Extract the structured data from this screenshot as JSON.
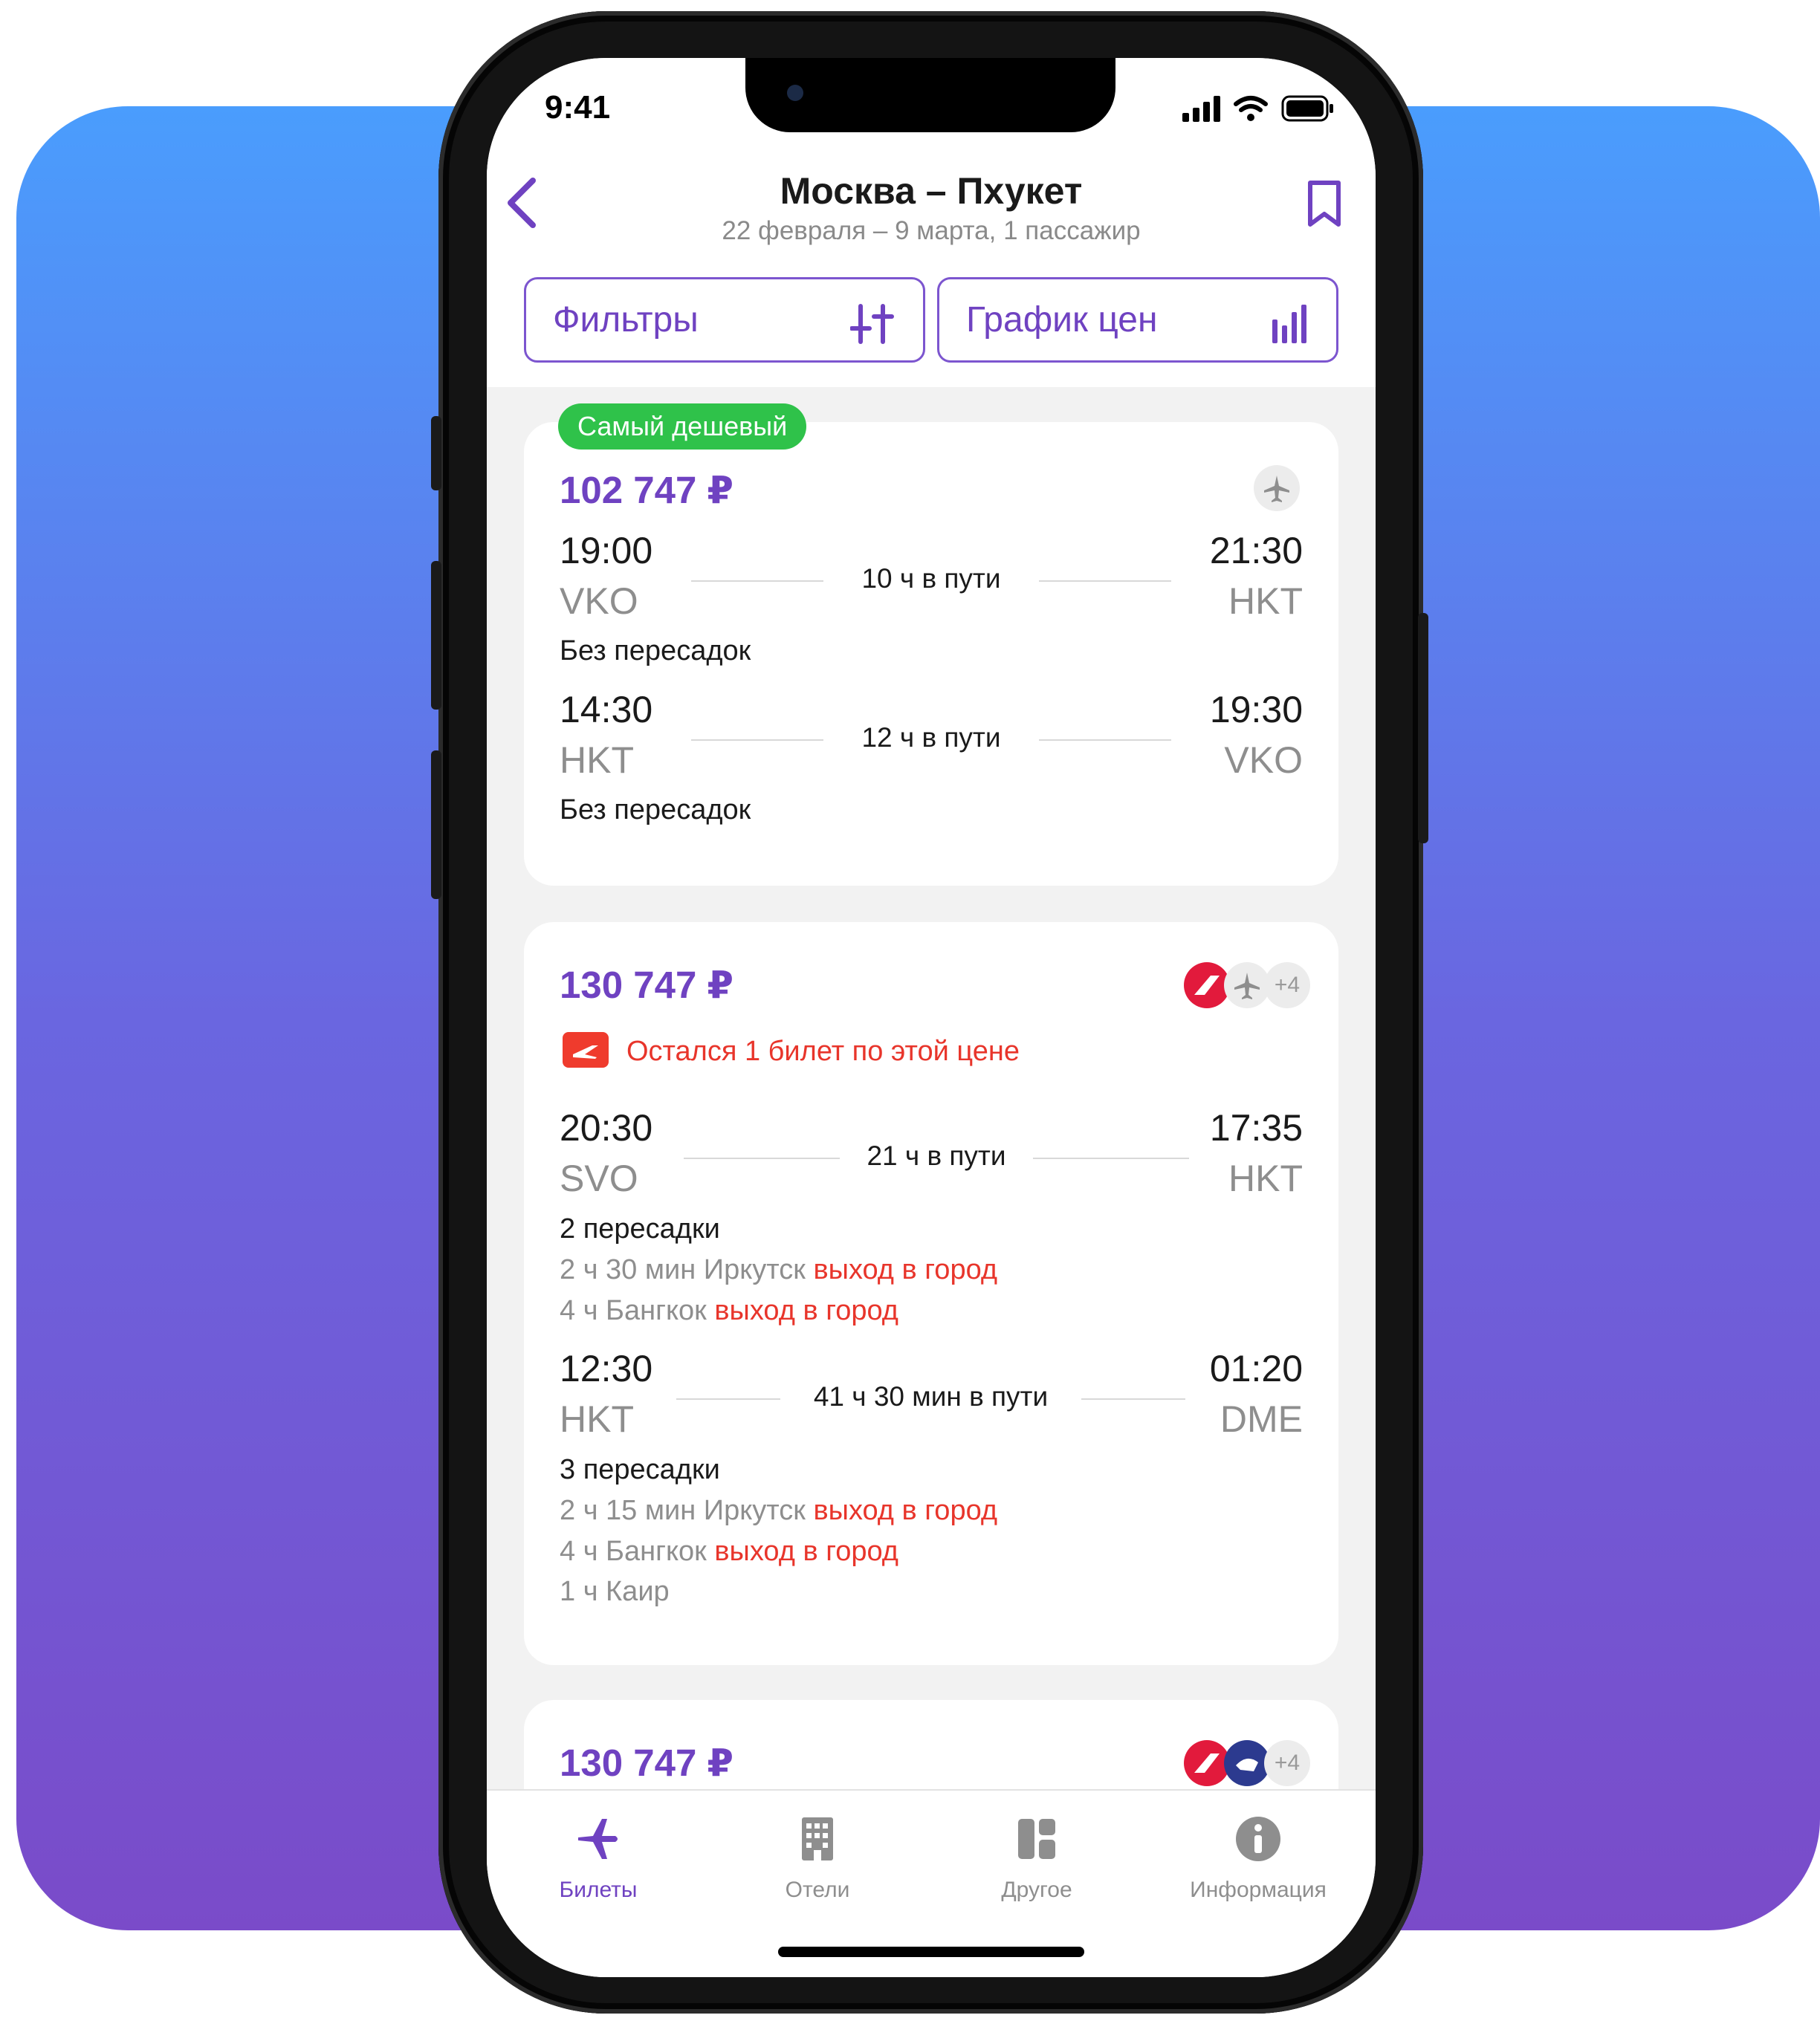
{
  "status": {
    "time": "9:41"
  },
  "header": {
    "title": "Москва – Пхукет",
    "subtitle": "22 февраля – 9 марта, 1 пассажир",
    "filters_label": "Фильтры",
    "price_chart_label": "График цен"
  },
  "cards": [
    {
      "badge": "Самый дешевый",
      "price": "102 747 ₽",
      "legs": [
        {
          "dep_time": "19:00",
          "dep_code": "VKO",
          "duration": "10 ч в пути",
          "arr_time": "21:30",
          "arr_code": "HKT",
          "stops": "Без пересадок"
        },
        {
          "dep_time": "14:30",
          "dep_code": "HKT",
          "duration": "12 ч в пути",
          "arr_time": "19:30",
          "arr_code": "VKO",
          "stops": "Без пересадок"
        }
      ]
    },
    {
      "price": "130 747 ₽",
      "extra_airlines": "+4",
      "alert": "Остался 1 билет по этой цене",
      "legs": [
        {
          "dep_time": "20:30",
          "dep_code": "SVO",
          "duration": "21 ч в пути",
          "arr_time": "17:35",
          "arr_code": "HKT",
          "stops": "2 пересадки",
          "layovers": [
            {
              "text": "2 ч 30 мин Иркутск",
              "note": "выход в город"
            },
            {
              "text": "4 ч Бангкок",
              "note": "выход в город"
            }
          ]
        },
        {
          "dep_time": "12:30",
          "dep_code": "HKT",
          "duration": "41 ч 30 мин в пути",
          "arr_time": "01:20",
          "arr_code": "DME",
          "stops": "3 пересадки",
          "layovers": [
            {
              "text": "2 ч 15 мин Иркутск",
              "note": "выход в город"
            },
            {
              "text": "4 ч Бангкок",
              "note": "выход в город"
            },
            {
              "text": "1 ч Каир",
              "note": ""
            }
          ]
        }
      ]
    },
    {
      "price": "130 747 ₽",
      "extra_airlines": "+4"
    }
  ],
  "tabs": [
    {
      "label": "Билеты",
      "icon": "plane-icon",
      "active": true
    },
    {
      "label": "Отели",
      "icon": "hotel-icon",
      "active": false
    },
    {
      "label": "Другое",
      "icon": "grid-icon",
      "active": false
    },
    {
      "label": "Информация",
      "icon": "info-icon",
      "active": false
    }
  ],
  "colors": {
    "accent": "#6f42c1",
    "badge_green": "#2fc24a",
    "alert_red": "#e8352b"
  }
}
